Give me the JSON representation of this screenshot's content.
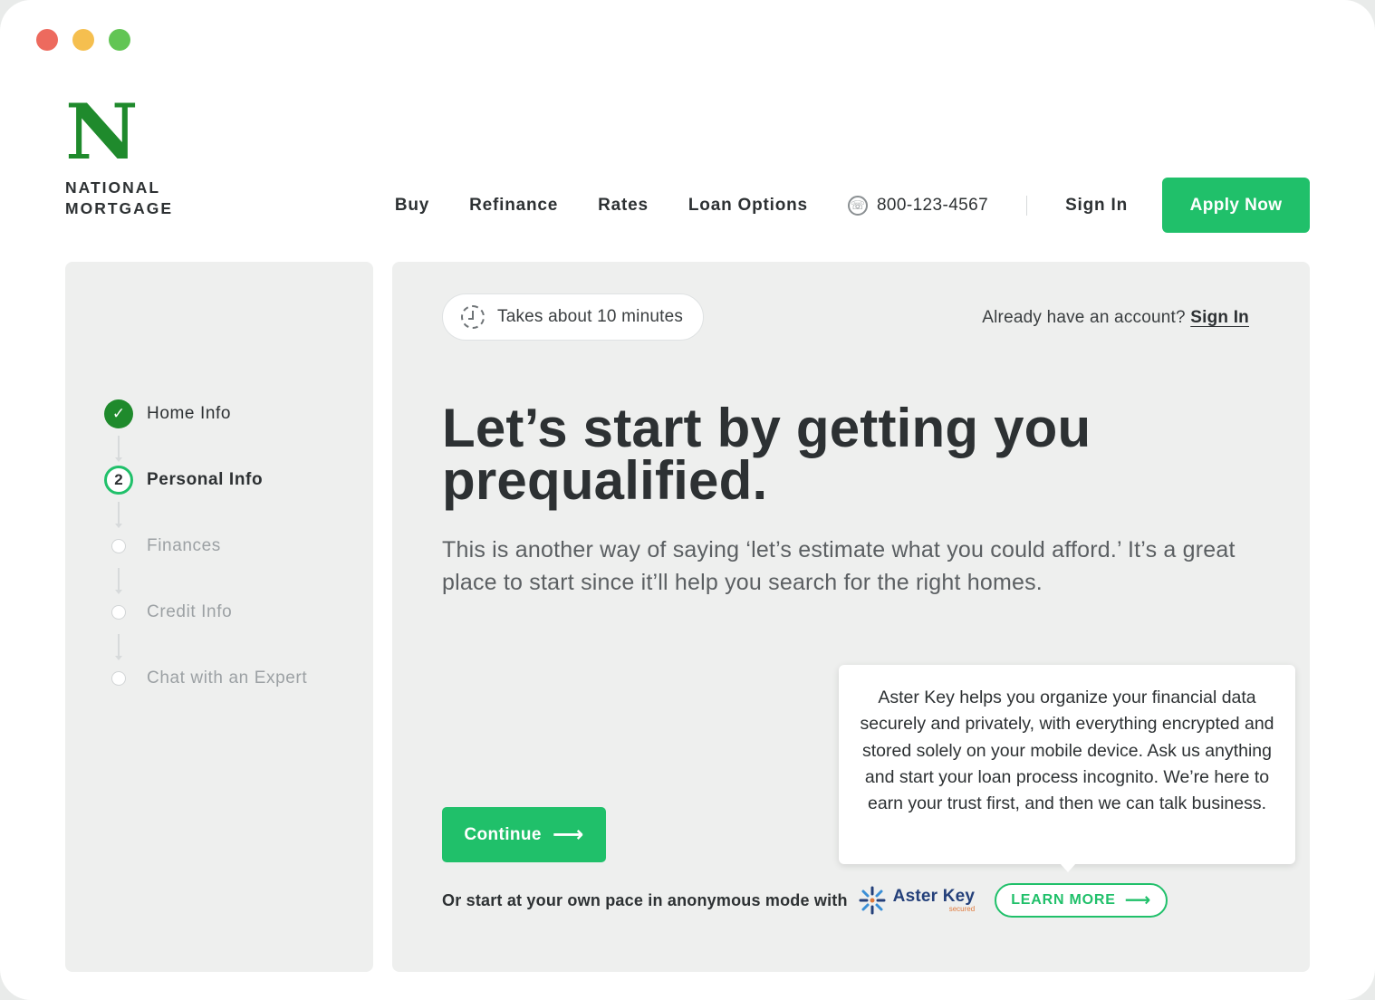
{
  "window": {
    "controls": [
      "close",
      "minimize",
      "zoom"
    ]
  },
  "brand": {
    "mark": "N",
    "name_line1": "NATIONAL",
    "name_line2": "MORTGAGE",
    "color": "#1f8a2c"
  },
  "nav": {
    "links": [
      "Buy",
      "Refinance",
      "Rates",
      "Loan Options"
    ],
    "phone_icon": "phone-icon",
    "phone": "800-123-4567",
    "signin": "Sign In",
    "apply": "Apply Now",
    "accent": "#20c06a"
  },
  "steps": [
    {
      "label": "Home Info",
      "status": "done"
    },
    {
      "label": "Personal Info",
      "status": "current",
      "number": "2"
    },
    {
      "label": "Finances",
      "status": "todo"
    },
    {
      "label": "Credit Info",
      "status": "todo"
    },
    {
      "label": "Chat with an Expert",
      "status": "todo"
    }
  ],
  "main": {
    "time_estimate": "Takes about 10 minutes",
    "account_prompt": "Already have an account?",
    "account_link": "Sign In",
    "headline": "Let’s start by getting you prequalified.",
    "subtext": "This is another way of saying ‘let’s estimate what you could afford.’ It’s a great place to start since it’ll help you search for the right homes.",
    "continue": "Continue",
    "anon_text": "Or start at your own pace in anonymous mode with",
    "aster_name": "Aster Key",
    "aster_sub": "secured",
    "learn_more": "LEARN MORE",
    "tooltip": "Aster Key helps you organize your financial data securely and privately, with everything encrypted and stored solely on your mobile device. Ask us anything and start your loan process incognito. We’re here to earn your trust first, and then we can talk business."
  }
}
